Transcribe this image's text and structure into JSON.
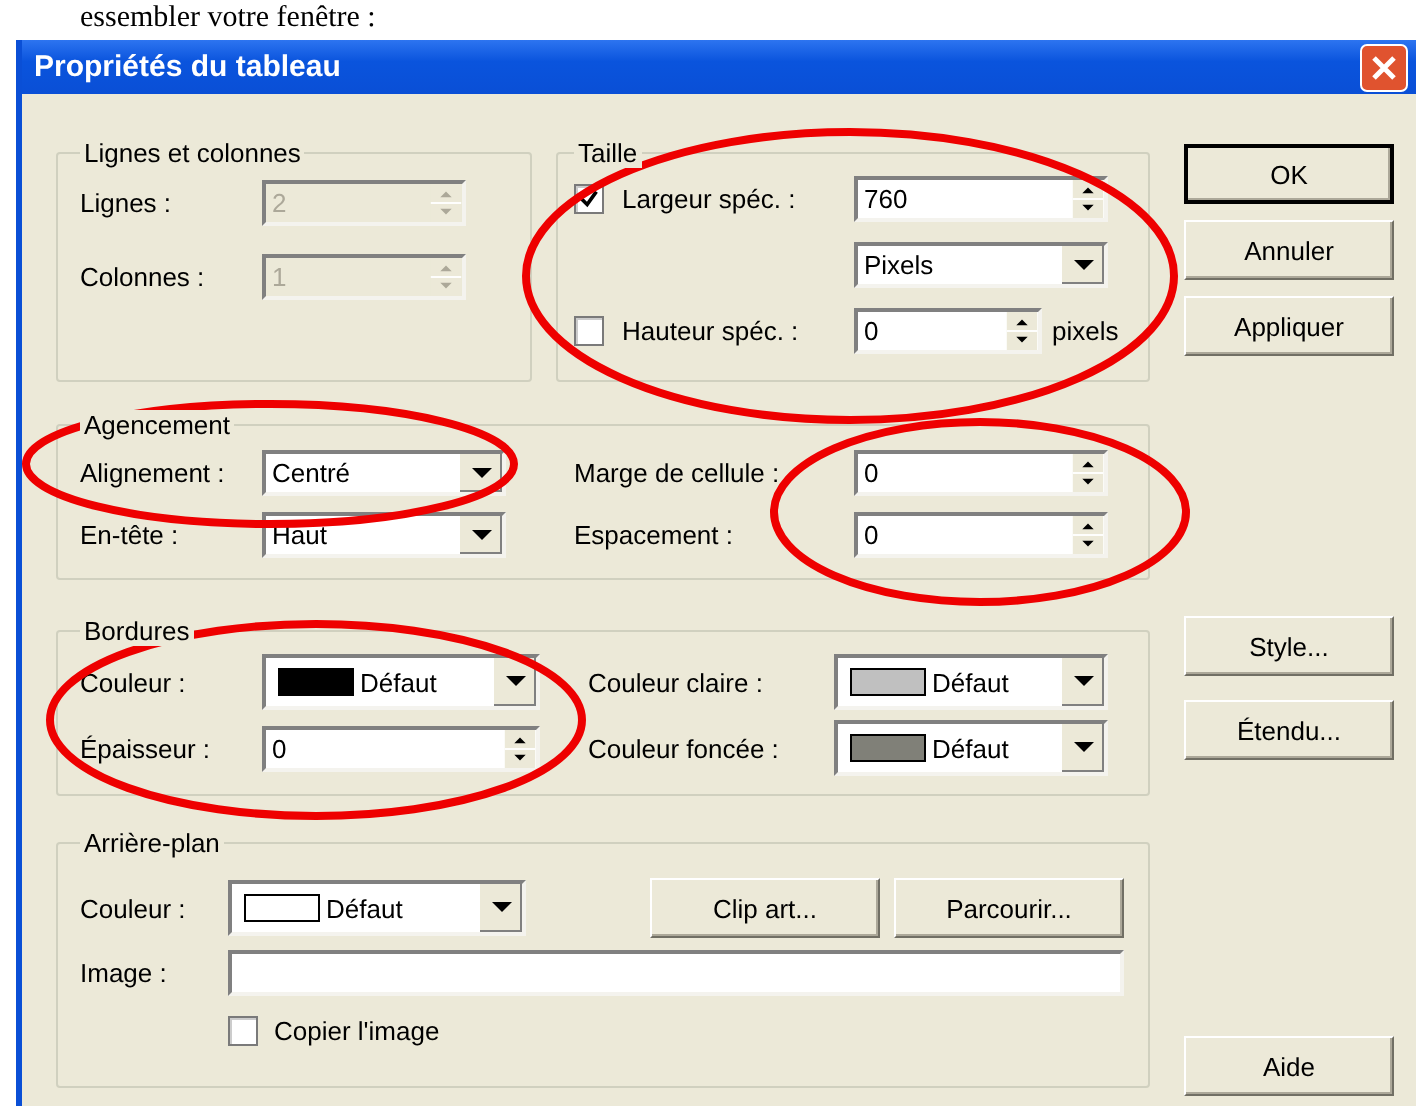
{
  "caption": "essembler votre fenêtre :",
  "window": {
    "title": "Propriétés du tableau"
  },
  "rows_columns": {
    "title": "Lignes et colonnes",
    "fields": [
      {
        "label": "Lignes :",
        "value": "2",
        "disabled": true
      },
      {
        "label": "Colonnes :",
        "value": "1",
        "disabled": true
      }
    ]
  },
  "size": {
    "title": "Taille",
    "width": {
      "label": "Largeur spéc. :",
      "checked": true,
      "value": "760",
      "unit": "Pixels"
    },
    "height": {
      "label": "Hauteur spéc. :",
      "checked": false,
      "value": "0",
      "suffix": "pixels"
    }
  },
  "layout": {
    "title": "Agencement",
    "alignment": {
      "label": "Alignement :",
      "value": "Centré"
    },
    "header": {
      "label": "En-tête :",
      "value": "Haut"
    },
    "cell_padding": {
      "label": "Marge de cellule :",
      "value": "0"
    },
    "spacing": {
      "label": "Espacement :",
      "value": "0"
    }
  },
  "borders": {
    "title": "Bordures",
    "color": {
      "label": "Couleur :",
      "value": "Défaut",
      "color": "#000000"
    },
    "thickness": {
      "label": "Épaisseur :",
      "value": "0"
    },
    "light_color": {
      "label": "Couleur claire :",
      "value": "Défaut",
      "color": "#c0c0c0"
    },
    "dark_color": {
      "label": "Couleur foncée :",
      "value": "Défaut",
      "color": "#808078"
    }
  },
  "background": {
    "title": "Arrière-plan",
    "color": {
      "label": "Couleur :",
      "value": "Défaut",
      "color": "#ffffff"
    },
    "buttons": [
      "Clip art...",
      "Parcourir..."
    ],
    "image": {
      "label": "Image :"
    },
    "copy_image": {
      "label": "Copier l'image",
      "checked": false
    }
  },
  "buttons_top": [
    {
      "label": "OK",
      "default": true
    },
    {
      "label": "Annuler",
      "default": false
    },
    {
      "label": "Appliquer",
      "default": false
    }
  ],
  "buttons_middle": [
    {
      "label": "Style...",
      "default": false
    },
    {
      "label": "Étendu...",
      "default": false
    }
  ],
  "buttons_bottom": [
    {
      "label": "Aide",
      "default": false
    }
  ]
}
